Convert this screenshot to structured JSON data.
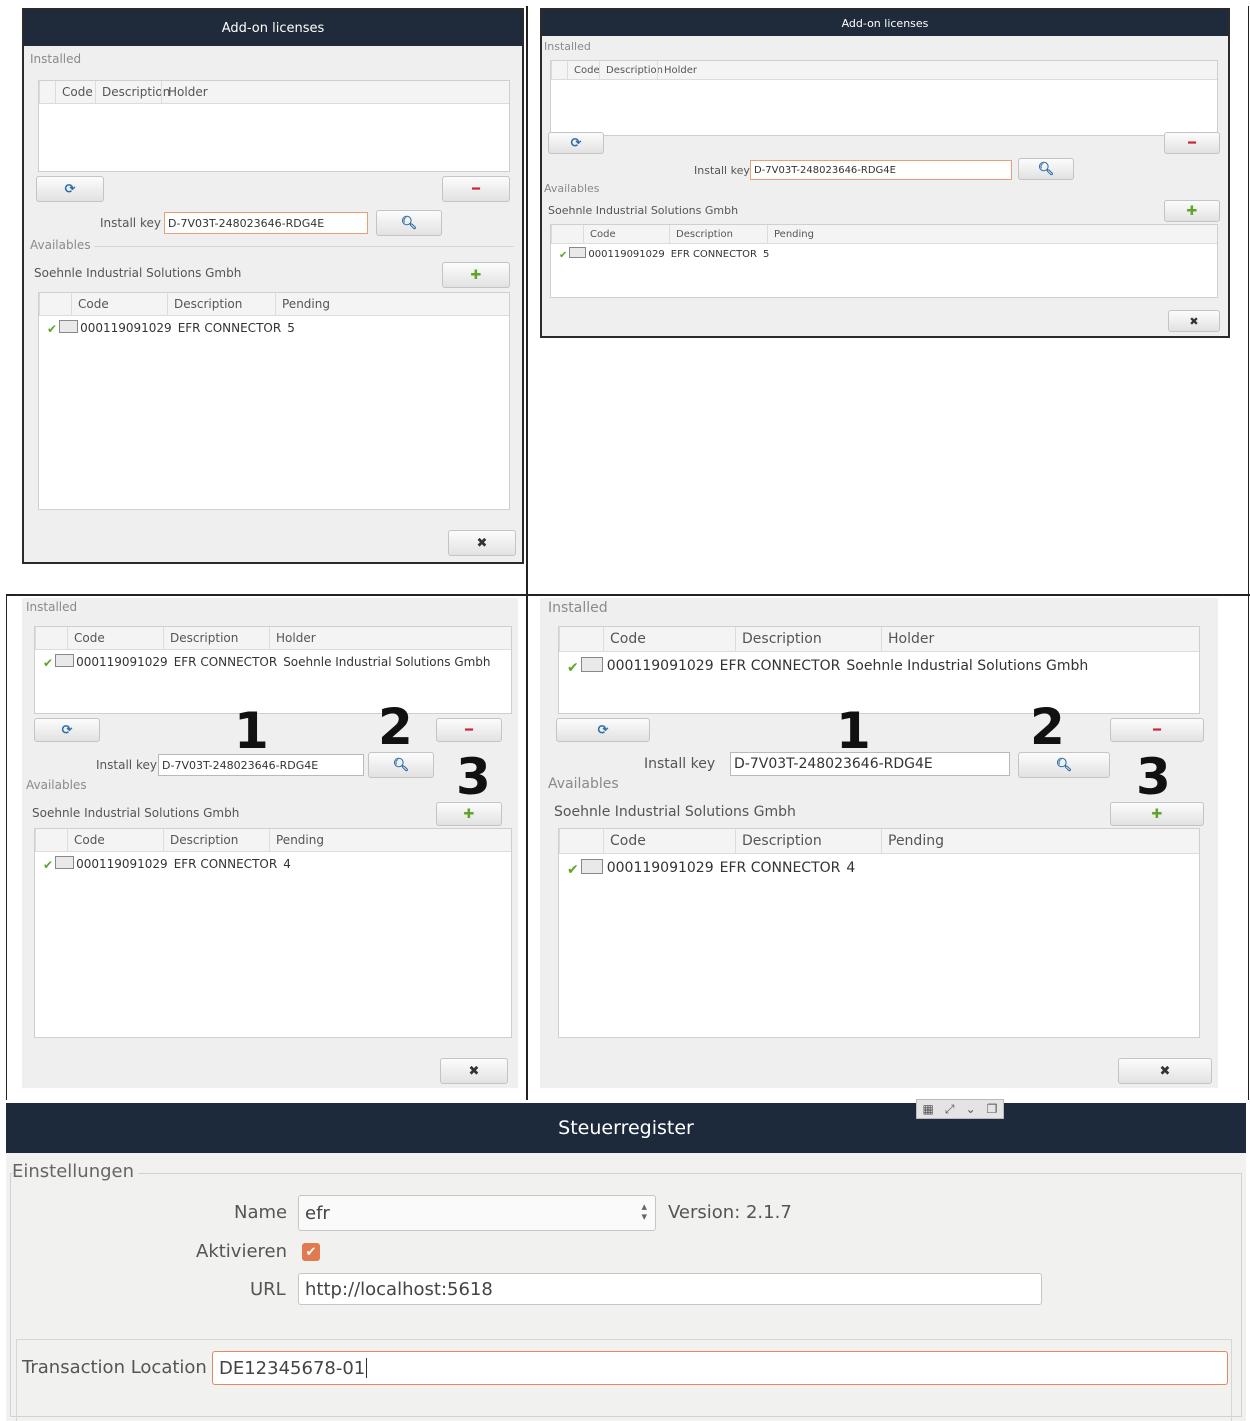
{
  "dialog": {
    "title": "Add-on licenses",
    "installed": "Installed",
    "availables": "Availables",
    "install_key_label": "Install key",
    "install_key_value": "D-7V03T-248023646-RDG4E",
    "vendor": "Soehnle Industrial Solutions Gmbh",
    "installed_headers": [
      "Code",
      "Description",
      "Holder"
    ],
    "available_headers": [
      "Code",
      "Description",
      "Pending"
    ],
    "row_code": "000119091029",
    "row_description": "EFR CONNECTOR",
    "row_holder": "Soehnle Industrial Solutions Gmbh",
    "pending_before": "5",
    "pending_after": "4"
  },
  "icons": {
    "refresh": "refresh-icon",
    "remove": "minus-icon",
    "search": "search-icon",
    "add": "plus-icon",
    "close": "close-icon",
    "check": "check-icon",
    "document": "document-icon"
  },
  "annotations": {
    "n1": "1",
    "n2": "2",
    "n3": "3"
  },
  "steuer": {
    "title": "Steuerregister",
    "section": "Einstellungen",
    "name_label": "Name",
    "name_value": "efr",
    "version": "Version: 2.1.7",
    "activate_label": "Aktivieren",
    "activate_checked": true,
    "url_label": "URL",
    "url_value": "http://localhost:5618",
    "transaction_label": "Transaction Location",
    "transaction_value": "DE12345678-01"
  },
  "colors": {
    "titlebar": "#1f2a3a",
    "accent_green": "#5ea52a",
    "accent_red": "#c8283a",
    "accent_blue": "#2d6ea8",
    "checkbox_orange": "#e07b4f"
  }
}
